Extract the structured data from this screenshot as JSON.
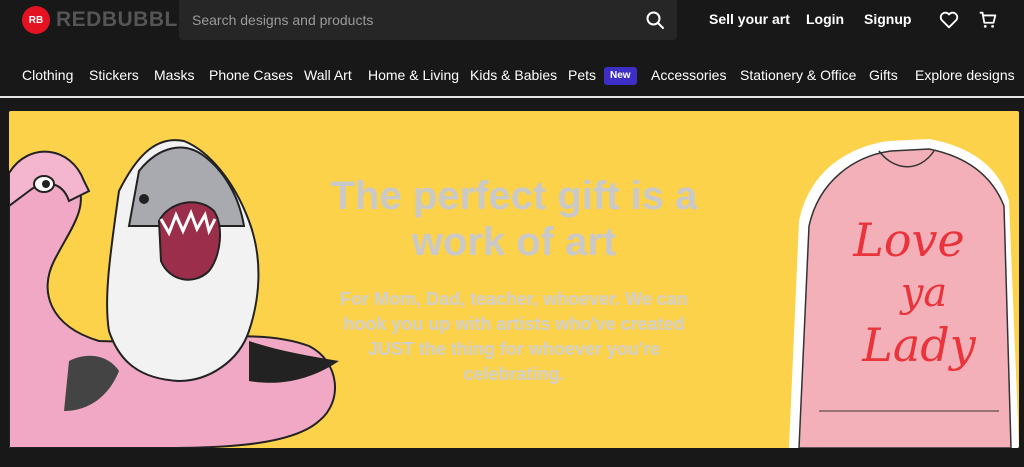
{
  "header": {
    "logo_text": "REDBUBBLE",
    "logo_mark": "RB",
    "search_placeholder": "Search designs and products",
    "sell_label": "Sell your art",
    "login_label": "Login",
    "signup_label": "Signup",
    "icons": [
      "search-icon",
      "heart-icon",
      "cart-icon"
    ]
  },
  "nav": {
    "items": [
      "Clothing",
      "Stickers",
      "Masks",
      "Phone Cases",
      "Wall Art",
      "Home & Living",
      "Kids & Babies",
      "Pets",
      "Accessories",
      "Stationery & Office",
      "Gifts",
      "Explore designs"
    ],
    "pets_badge": "New"
  },
  "hero": {
    "title": "The perfect gift is a work of art",
    "subtitle": "For Mom, Dad, teacher, whoever. We can hook you up with artists who've created JUST the thing for whoever you're celebrating.",
    "jacket_text": "Love ya Lady"
  },
  "colors": {
    "brand_red": "#e41321",
    "hero_yellow": "#fdd24b",
    "badge_purple": "#3d2ec6",
    "page_bg": "#181818"
  }
}
